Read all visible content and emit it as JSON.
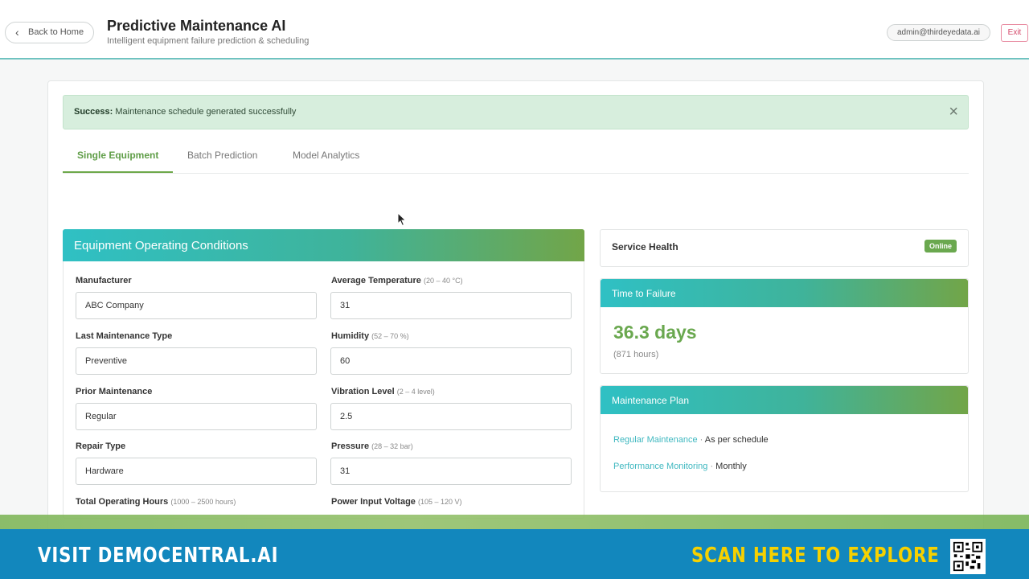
{
  "header": {
    "back_label": "Back to Home",
    "title": "Predictive Maintenance AI",
    "subtitle": "Intelligent equipment failure prediction & scheduling",
    "user_email": "admin@thirdeyedata.ai",
    "exit_label": "Exit"
  },
  "alert": {
    "prefix": "Success:",
    "message": "Maintenance schedule generated successfully",
    "close_icon": "close-icon"
  },
  "tabs": [
    {
      "label": "Single Equipment",
      "active": true
    },
    {
      "label": "Batch Prediction",
      "active": false
    },
    {
      "label": "Model Analytics",
      "active": false
    }
  ],
  "form": {
    "title": "Equipment Operating Conditions",
    "fields": [
      {
        "label": "Manufacturer",
        "hint": "",
        "value": "ABC Company"
      },
      {
        "label": "Average Temperature",
        "hint": "(20 – 40 °C)",
        "value": "31"
      },
      {
        "label": "Last Maintenance Type",
        "hint": "",
        "value": "Preventive"
      },
      {
        "label": "Humidity",
        "hint": "(52 – 70 %)",
        "value": "60"
      },
      {
        "label": "Prior Maintenance",
        "hint": "",
        "value": "Regular"
      },
      {
        "label": "Vibration Level",
        "hint": "(2 – 4 level)",
        "value": "2.5"
      },
      {
        "label": "Repair Type",
        "hint": "",
        "value": "Hardware"
      },
      {
        "label": "Pressure",
        "hint": "(28 – 32 bar)",
        "value": "31"
      },
      {
        "label": "Total Operating Hours",
        "hint": "(1000 – 2500 hours)",
        "value": ""
      },
      {
        "label": "Power Input Voltage",
        "hint": "(105 – 120 V)",
        "value": ""
      }
    ]
  },
  "service_health": {
    "label": "Service Health",
    "status": "Online",
    "status_color": "#6aa84f"
  },
  "time_to_failure": {
    "title": "Time to Failure",
    "value": "36.3 days",
    "hours": "(871 hours)"
  },
  "maintenance_plan": {
    "title": "Maintenance Plan",
    "items": [
      {
        "name": "Regular Maintenance",
        "sep": " · ",
        "detail": "As per schedule"
      },
      {
        "name": "Performance Monitoring",
        "sep": " · ",
        "detail": "Monthly"
      }
    ]
  },
  "banner": {
    "left_text": "VISIT DEMOCENTRAL.AI",
    "right_text": "SCAN HERE TO EXPLORE",
    "qr_icon": "qr-code-icon"
  },
  "colors": {
    "accent_green": "#6aa84f",
    "accent_teal": "#2fc0c4",
    "banner_blue": "#1287bd",
    "banner_yellow": "#f6d100"
  }
}
